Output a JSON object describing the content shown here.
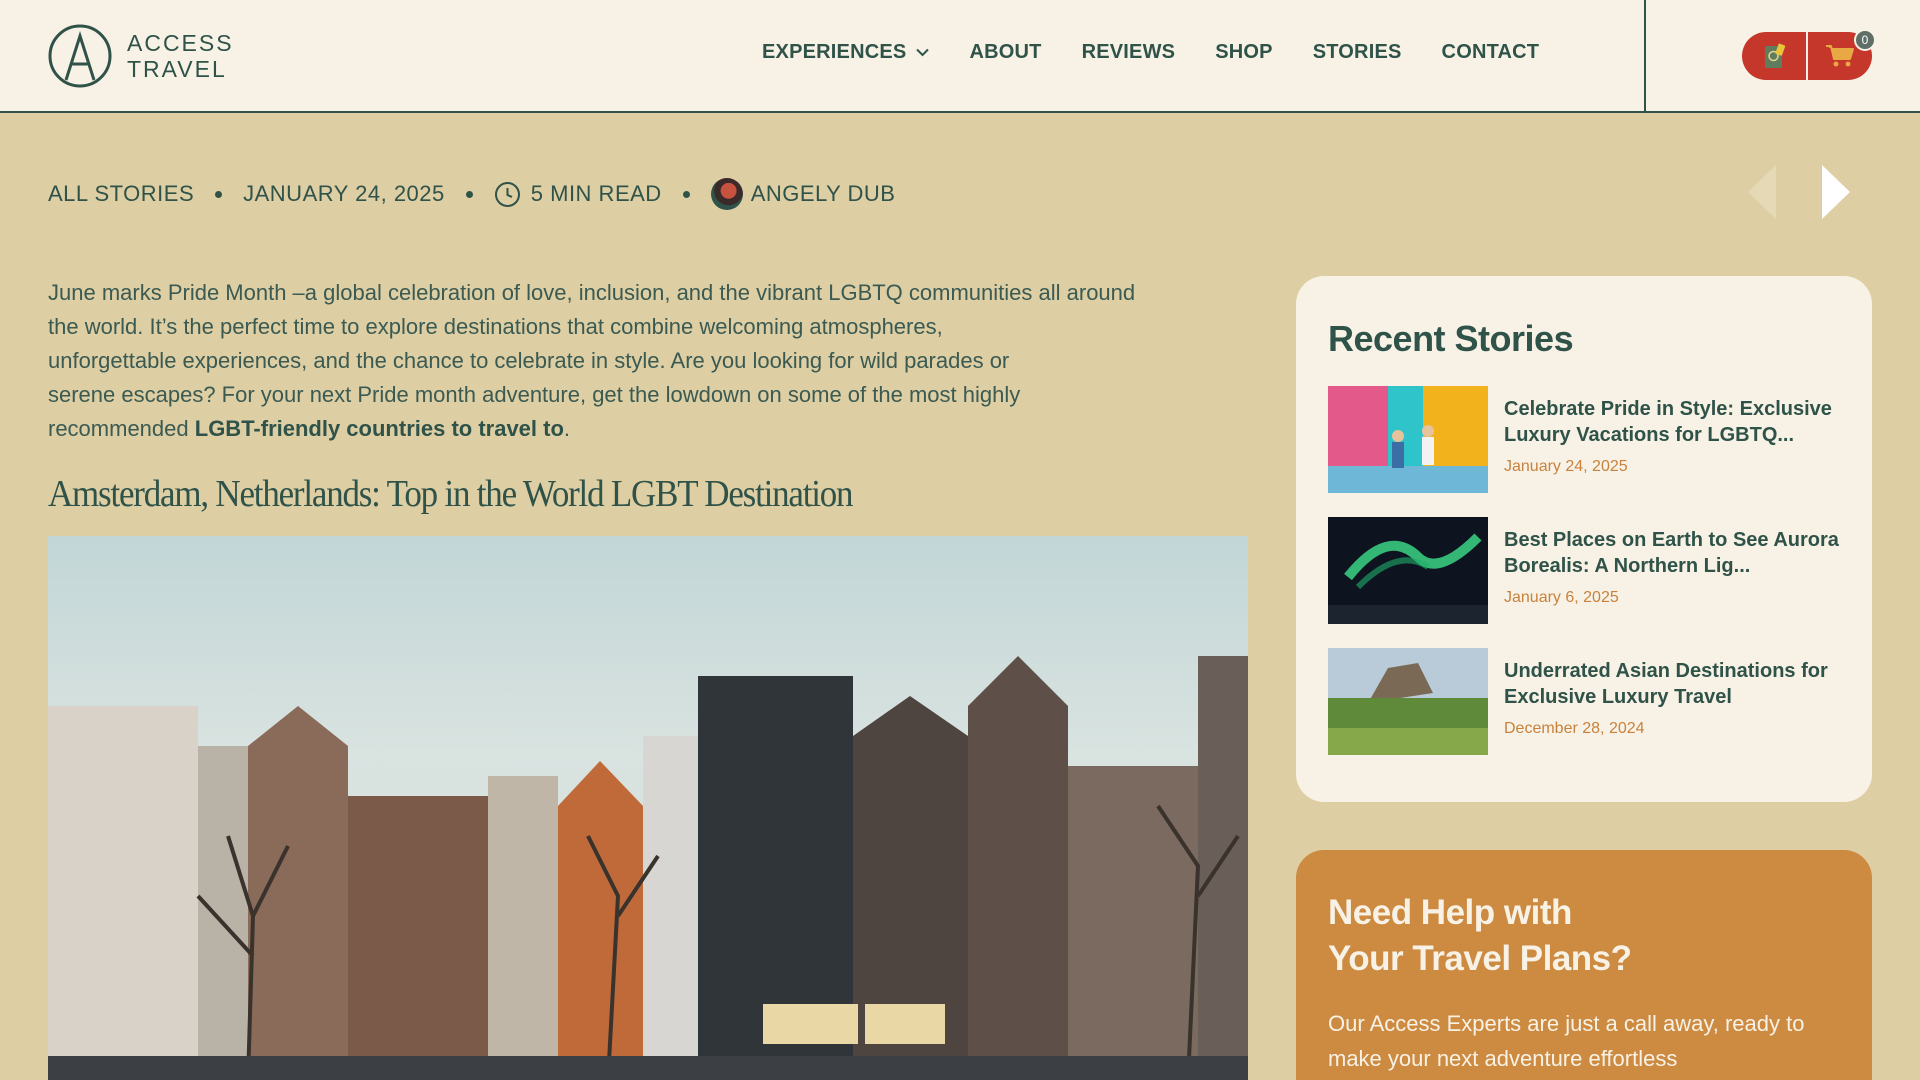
{
  "brand": {
    "line1": "ACCESS",
    "line2": "TRAVEL",
    "colors": {
      "primary": "#2f5249",
      "cream": "#f7f2e5",
      "sand": "#ddcea4",
      "red": "#c5362b",
      "orange": "#cd8a41"
    }
  },
  "nav": {
    "items": [
      {
        "label": "EXPERIENCES",
        "has_dropdown": true
      },
      {
        "label": "ABOUT"
      },
      {
        "label": "REVIEWS"
      },
      {
        "label": "SHOP"
      },
      {
        "label": "STORIES"
      },
      {
        "label": "CONTACT"
      }
    ]
  },
  "header_actions": {
    "passport_icon": "passport-icon",
    "cart_icon": "cart-icon",
    "cart_count": "0"
  },
  "meta": {
    "category": "ALL STORIES",
    "date": "JANUARY 24, 2025",
    "read_time": "5 MIN READ",
    "author": "ANGELY DUB"
  },
  "article": {
    "intro_lines": [
      "June marks Pride Month –a global celebration of love, inclusion, and the vibrant LGBTQ communities all around",
      "the world. It’s the perfect time to explore destinations that combine welcoming atmospheres,",
      "unforgettable experiences, and the chance to celebrate in style. Are you looking for wild parades or",
      "serene escapes? For your next Pride month adventure, get the lowdown on some of the most highly"
    ],
    "intro_last_prefix": "recommended ",
    "intro_link": "LGBT-friendly countries to travel to",
    "intro_last_suffix": ".",
    "section_title": "Amsterdam, Netherlands: Top in the World LGBT Destination"
  },
  "sidebar": {
    "recent_title": "Recent Stories",
    "stories": [
      {
        "title": "Celebrate Pride in Style: Exclusive Luxury Vacations for LGBTQ...",
        "date": "January 24, 2025"
      },
      {
        "title": "Best Places on Earth to See Aurora Borealis: A Northern Lig...",
        "date": "January 6, 2025"
      },
      {
        "title": "Underrated Asian Destinations for Exclusive Luxury Travel",
        "date": "December 28, 2024"
      }
    ],
    "help": {
      "title_line1": "Need Help with",
      "title_line2": "Your Travel Plans?",
      "text": "Our Access Experts are just a call away, ready to make your next adventure effortless"
    }
  }
}
